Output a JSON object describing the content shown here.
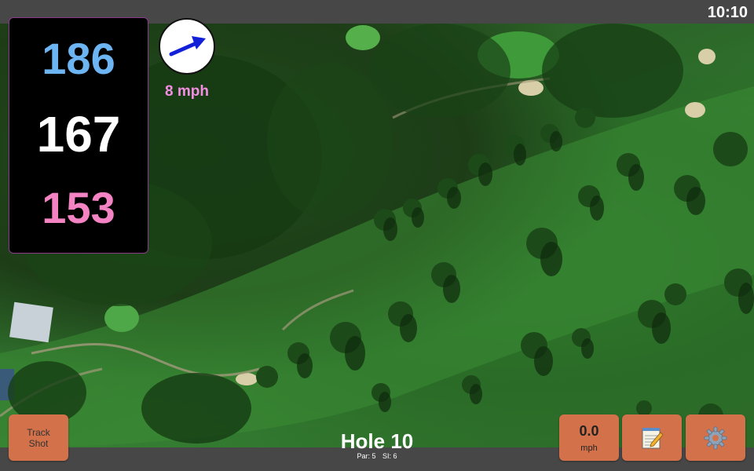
{
  "status_bar": {
    "time": "10:10"
  },
  "yardages": {
    "back": {
      "value": "186",
      "color": "#6cb4f2"
    },
    "middle": {
      "value": "167",
      "color": "#ffffff"
    },
    "front": {
      "value": "153",
      "color": "#f483c4"
    }
  },
  "wind": {
    "speed_label": "8 mph",
    "label_color": "#f48ee4",
    "arrow_icon": "wind-direction-arrow-icon",
    "arrow_color": "#1220d8"
  },
  "buttons": {
    "track_shot": {
      "line1": "Track",
      "line2": "Shot"
    },
    "speed": {
      "value": "0.0",
      "unit": "mph"
    },
    "notes_icon": "notepad-icon",
    "settings_icon": "gear-icon",
    "button_color": "#d2714a"
  },
  "hole": {
    "title": "Hole 10",
    "par": "Par: 5",
    "si": "SI: 6"
  },
  "map": {
    "icon": "satellite-course-map"
  }
}
